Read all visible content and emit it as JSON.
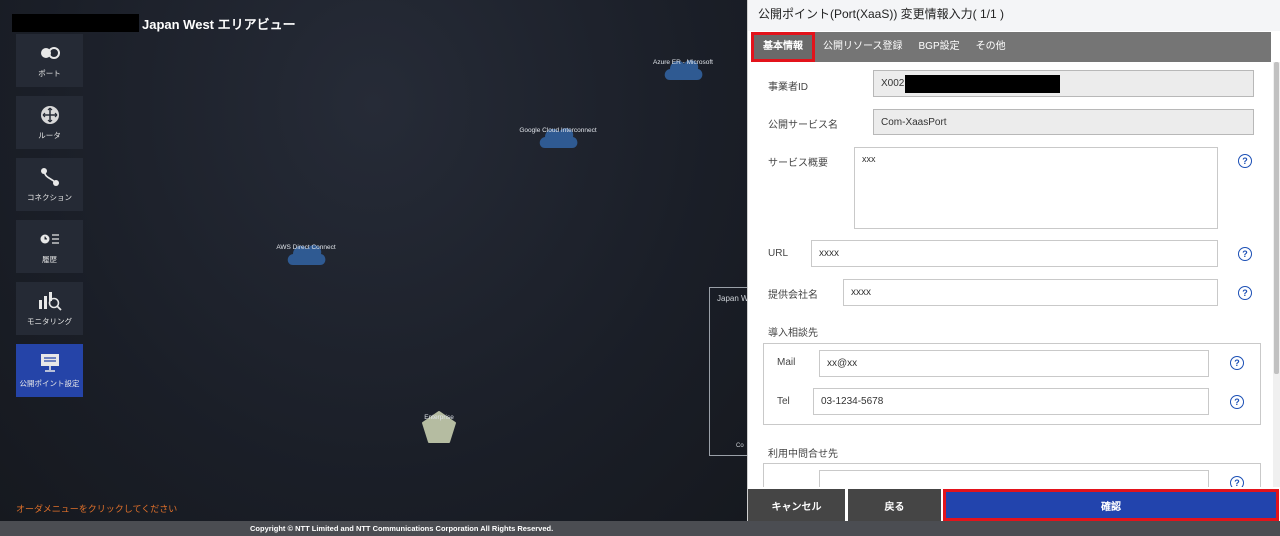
{
  "header": {
    "title": "Japan West エリアビュー"
  },
  "sidebar": {
    "items": [
      {
        "label": "ポート",
        "icon": "port-icon"
      },
      {
        "label": "ルータ",
        "icon": "router-icon"
      },
      {
        "label": "コネクション",
        "icon": "connection-icon"
      },
      {
        "label": "履歴",
        "icon": "history-icon"
      },
      {
        "label": "モニタリング",
        "icon": "monitoring-icon"
      },
      {
        "label": "公開ポイント設定",
        "icon": "public-point-icon",
        "active": true
      }
    ]
  },
  "map": {
    "clouds": [
      {
        "label": "Azure ER - Microsoft"
      },
      {
        "label": "Google Cloud Interconnect"
      },
      {
        "label": "AWS Direct Connect"
      }
    ],
    "enterprise_label": "Enterprise",
    "japan_box_label": "Japan W",
    "japan_box_sub": "Co",
    "order_hint": "オーダメニューをクリックしてください"
  },
  "footer": {
    "copyright": "Copyright © NTT Limited and NTT Communications Corporation All Rights Reserved."
  },
  "panel": {
    "title": "公開ポイント(Port(XaaS)) 変更情報入力( 1/1 )",
    "tabs": [
      "基本情報",
      "公開リソース登録",
      "BGP設定",
      "その他"
    ],
    "fields": {
      "operator_id": {
        "label": "事業者ID",
        "value": "X002"
      },
      "service_name": {
        "label": "公開サービス名",
        "value": "Com-XaasPort"
      },
      "service_summary": {
        "label": "サービス概要",
        "value": "xxx"
      },
      "url": {
        "label": "URL",
        "value": "xxxx"
      },
      "company": {
        "label": "提供会社名",
        "value": "xxxx"
      },
      "intro_contact": {
        "label": "導入相談先",
        "mail_label": "Mail",
        "mail_value": "xx@xx",
        "tel_label": "Tel",
        "tel_value": "03-1234-5678"
      },
      "usage_contact": {
        "label": "利用中問合せ先"
      }
    },
    "help_glyph": "?",
    "buttons": {
      "cancel": "キャンセル",
      "back": "戻る",
      "confirm": "確認"
    }
  },
  "colors": {
    "accent": "#2244ad",
    "highlight": "#e3131b",
    "hint": "#e0702a"
  }
}
